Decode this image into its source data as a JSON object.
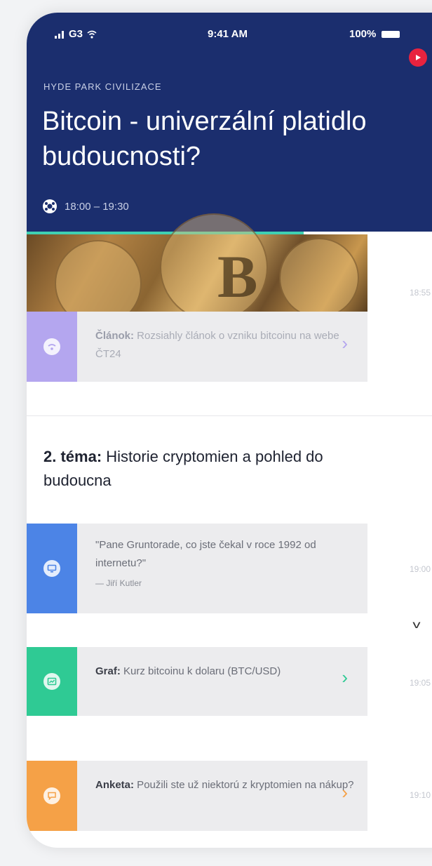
{
  "status_bar": {
    "carrier": "G3",
    "time": "9:41 AM",
    "battery": "100%"
  },
  "header": {
    "category": "HYDE PARK CIVILIZACE",
    "title": "Bitcoin - univerzální platidlo budoucnosti?",
    "time_range": "18:00 – 19:30",
    "progress": 0.66,
    "live_icon": "play-icon"
  },
  "feed": {
    "image_timestamp": "18:55",
    "article": {
      "type_label": "Článok:",
      "text": " Rozsiahly článok o vzniku bitcoinu na webe ČT24",
      "icon": "wifi-icon",
      "color": "#b4a6ef"
    },
    "topic": {
      "number_label": "2. téma:",
      "title": " Historie cryptomien a pohled do budoucna"
    },
    "quote": {
      "text": "\"Pane Gruntorade, co jste čekal v roce 1992 od internetu?\"",
      "author": "— Jiří Kutler",
      "timestamp": "19:00",
      "icon": "monitor-icon",
      "color": "#4c84e6"
    },
    "graph": {
      "type_label": "Graf:",
      "text": " Kurz bitcoinu k dolaru (BTC/USD)",
      "timestamp": "19:05",
      "icon": "chart-icon",
      "color": "#2fca94"
    },
    "poll": {
      "type_label": "Anketa:",
      "text": " Použili ste už niektorú z kryptomien na nákup?",
      "timestamp": "19:10",
      "icon": "chat-icon",
      "color": "#f5a147"
    }
  }
}
